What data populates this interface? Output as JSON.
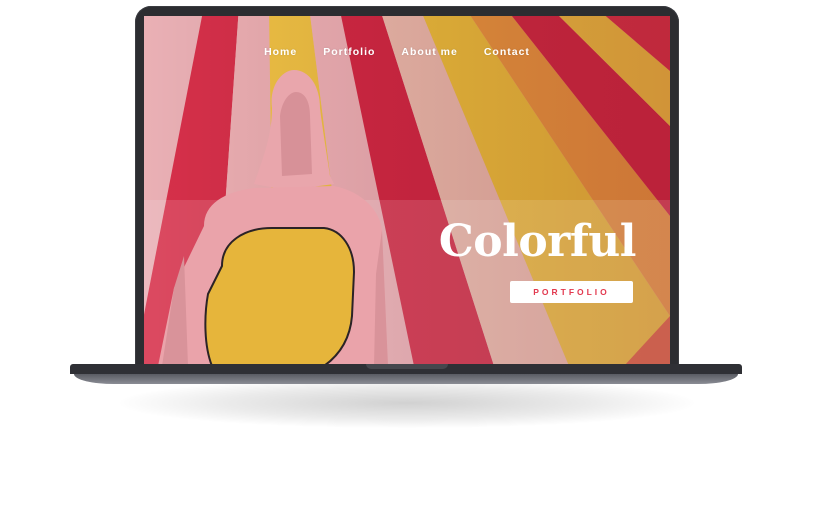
{
  "nav": {
    "items": [
      {
        "label": "Home"
      },
      {
        "label": "Portfolio"
      },
      {
        "label": "About me"
      },
      {
        "label": "Contact"
      }
    ]
  },
  "hero": {
    "title": "Colorful",
    "button_label": "PORTFOLIO"
  },
  "colors": {
    "accent": "#e2394f",
    "stripe_red": "#d8243f",
    "stripe_yellow": "#f2c23c",
    "stripe_pink": "#f0b1b6",
    "hoodie_pink": "#e8a2a8",
    "hoodie_yellow": "#e6b53a",
    "laptop_body": "#2c2d31"
  }
}
